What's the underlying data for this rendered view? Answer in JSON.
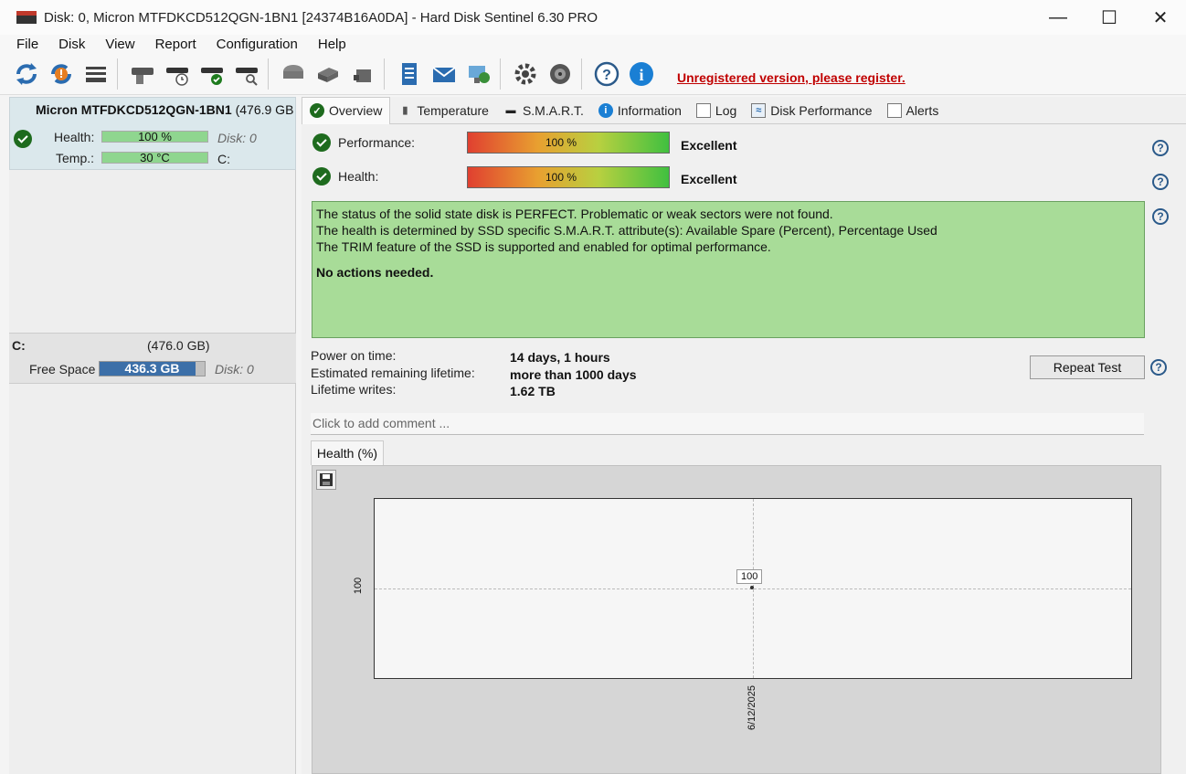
{
  "window": {
    "title": "Disk: 0, Micron MTFDKCD512QGN-1BN1 [24374B16A0DA]  -  Hard Disk Sentinel 6.30 PRO",
    "controls": [
      "minimize",
      "maximize",
      "close"
    ]
  },
  "menu": [
    "File",
    "Disk",
    "View",
    "Report",
    "Configuration",
    "Help"
  ],
  "toolbar": {
    "icons": [
      "refresh-icon",
      "refresh-warning-icon",
      "disk-list-icon",
      "disk-icon",
      "disk-clock-icon",
      "disk-check-icon",
      "disk-search-icon",
      "drive-icon",
      "drive-tools-icon",
      "drive-alert-icon",
      "report-icon",
      "mail-icon",
      "network-icon",
      "settings-icon",
      "sound-icon",
      "help-icon",
      "info-icon"
    ],
    "register_text": "Unregistered version, please register."
  },
  "disk": {
    "name": "Micron MTFDKCD512QGN-1BN1",
    "size": "(476.9 GB",
    "health_label": "Health:",
    "health_value": "100 %",
    "health_level_pct": 100,
    "disk_index": "Disk: 0",
    "temp_label": "Temp.:",
    "temp_value": "30 °C",
    "temp_drive": "C:"
  },
  "partition": {
    "letter": "C:",
    "size": "(476.0 GB)",
    "free_label": "Free Space",
    "free_value": "436.3 GB",
    "free_fraction": 0.917,
    "disk_index": "Disk: 0"
  },
  "tabs": [
    "Overview",
    "Temperature",
    "S.M.A.R.T.",
    "Information",
    "Log",
    "Disk Performance",
    "Alerts"
  ],
  "overview": {
    "performance_label": "Performance:",
    "performance_value": "100 %",
    "performance_rating": "Excellent",
    "health_label": "Health:",
    "health_value": "100 %",
    "health_rating": "Excellent",
    "status_lines": [
      "The status of the solid state disk is PERFECT. Problematic or weak sectors were not found.",
      "The health is determined by SSD specific S.M.A.R.T. attribute(s):  Available Spare (Percent), Percentage Used",
      "The TRIM feature of the SSD is supported and enabled for optimal performance."
    ],
    "status_action": "No actions needed.",
    "power_on_label": "Power on time:",
    "power_on_value": "14 days, 1 hours",
    "lifetime_label": "Estimated remaining lifetime:",
    "lifetime_value": "more than 1000 days",
    "writes_label": "Lifetime writes:",
    "writes_value": "1.62 TB",
    "repeat_test": "Repeat Test",
    "comment_placeholder": "Click to add comment ...",
    "chart_tab": "Health (%)"
  },
  "chart_data": {
    "type": "line",
    "x": [
      "6/12/2025"
    ],
    "series": [
      {
        "values": [
          100
        ]
      }
    ],
    "y_ticks": [
      "100"
    ],
    "x_ticks": [
      "6/12/2025"
    ],
    "point_labels": [
      "100"
    ]
  }
}
